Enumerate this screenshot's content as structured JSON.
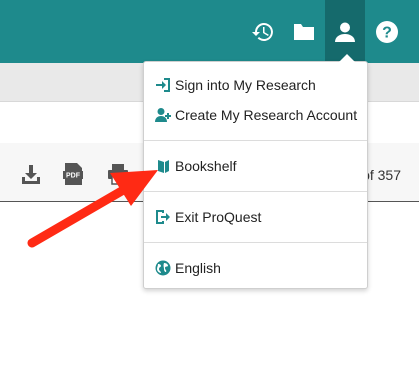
{
  "colors": {
    "topbar": "#1e8a8c",
    "active": "#156a6c",
    "icon": "#1e8a8c",
    "arrow": "#ff2a14"
  },
  "topbar": {
    "icons": [
      "history-icon",
      "folder-icon",
      "user-icon",
      "help-icon"
    ],
    "help_symbol": "?"
  },
  "toolbar": {
    "icons": [
      "download-icon",
      "pdf-icon",
      "print-icon"
    ],
    "pdf_label": "PDF",
    "page_count": "of 357"
  },
  "menu": {
    "items": [
      {
        "label": "Sign into My Research",
        "icon": "sign-in-icon"
      },
      {
        "label": "Create My Research Account",
        "icon": "add-user-icon"
      },
      {
        "label": "Bookshelf",
        "icon": "book-icon"
      },
      {
        "label": "Exit ProQuest",
        "icon": "exit-icon"
      },
      {
        "label": "English",
        "icon": "globe-icon"
      }
    ]
  }
}
